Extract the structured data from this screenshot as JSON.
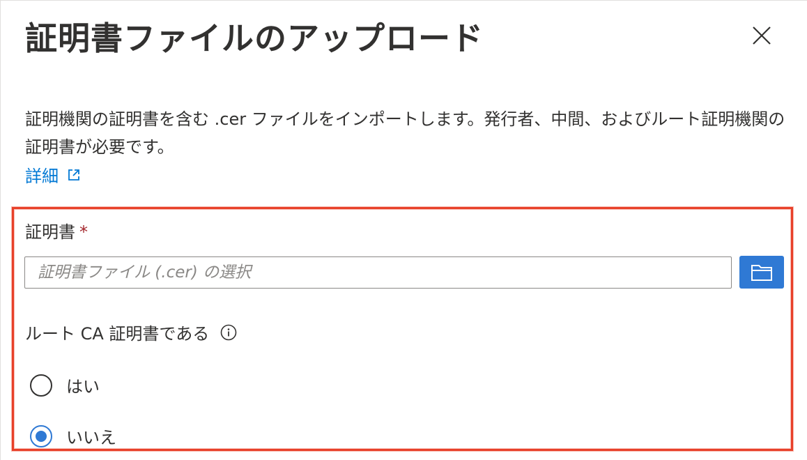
{
  "dialog": {
    "title": "証明書ファイルのアップロード",
    "description": "証明機関の証明書を含む .cer ファイルをインポートします。発行者、中間、およびルート証明機関の証明書が必要です。",
    "learn_more": "詳細"
  },
  "form": {
    "certificate_label": "証明書",
    "required_marker": "*",
    "file_placeholder": "証明書ファイル (.cer) の選択",
    "file_value": "",
    "root_ca_label": "ルート CA 証明書である",
    "options": [
      {
        "label": "はい",
        "selected": false
      },
      {
        "label": "いいえ",
        "selected": true
      }
    ]
  },
  "colors": {
    "accent": "#2f79d4",
    "link": "#0078d4",
    "highlight_border": "#e8412a",
    "required": "#a4262c"
  },
  "icons": {
    "close": "close-icon",
    "external_link": "external-link-icon",
    "browse": "folder-icon",
    "info": "info-icon"
  }
}
